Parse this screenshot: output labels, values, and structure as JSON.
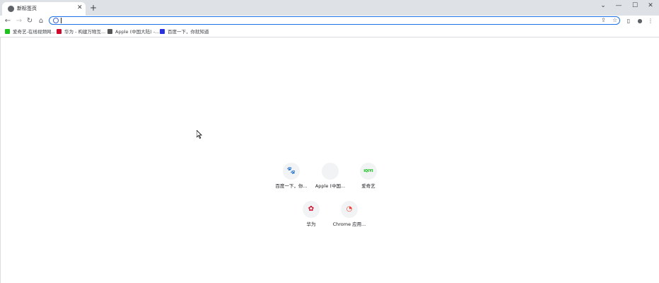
{
  "tab": {
    "title": "新标签页",
    "close": "✕"
  },
  "newtab": {
    "label": "+"
  },
  "window": {
    "minimize": "—",
    "maximize": "☐",
    "close": "✕",
    "tabsearch": "⌄"
  },
  "nav": {
    "back": "←",
    "forward": "→",
    "reload": "↻",
    "home": "⌂"
  },
  "omnibox": {
    "value": "",
    "share": "⇪",
    "star": "☆"
  },
  "toolbar": {
    "sidepanel": "▯",
    "profile": "●",
    "menu": "⋮"
  },
  "bookmarks": [
    {
      "label": "爱奇艺-在线视频网...",
      "icon_color": "#1ec21e"
    },
    {
      "label": "华为 - 构建万物互...",
      "icon_color": "#cf0a2c"
    },
    {
      "label": "Apple (中国大陆) -...",
      "icon_color": "#555555"
    },
    {
      "label": "百度一下，你就知道",
      "icon_color": "#2932e1"
    }
  ],
  "shortcuts": [
    {
      "label": "百度一下，你...",
      "glyph": "🐾",
      "color": "#2932e1"
    },
    {
      "label": "Apple (中国...",
      "glyph": "",
      "color": "#6e6e73"
    },
    {
      "label": "爱奇艺",
      "glyph": "iQIYI",
      "color": "#00be06"
    },
    {
      "label": "华为",
      "glyph": "✿",
      "color": "#cf0a2c"
    },
    {
      "label": "Chrome 应用...",
      "glyph": "◔",
      "color": "#ea4335"
    }
  ]
}
